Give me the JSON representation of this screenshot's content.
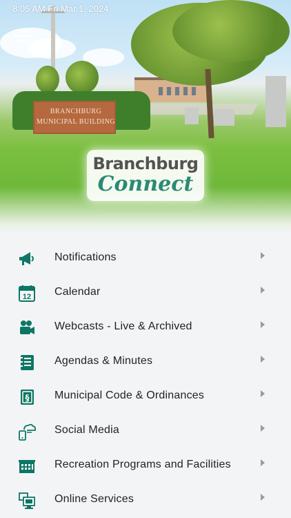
{
  "status_bar": {
    "time_date": "8:05 AM  Fri Mar 1, 2024"
  },
  "header": {
    "background_sign_line1": "BRANCHBURG",
    "background_sign_line2": "MUNICIPAL BUILDING",
    "logo_top": "Branchburg",
    "logo_bottom": "Connect"
  },
  "colors": {
    "accent": "#0e7665",
    "logo_green": "#2b8a73",
    "menu_bg": "#f3f4f6",
    "label": "#222222",
    "chevron": "#9a9a9a"
  },
  "menu": {
    "items": [
      {
        "label": "Notifications",
        "icon": "megaphone-icon"
      },
      {
        "label": "Calendar",
        "icon": "calendar-icon"
      },
      {
        "label": "Webcasts - Live & Archived",
        "icon": "video-camera-icon"
      },
      {
        "label": "Agendas & Minutes",
        "icon": "notebook-icon"
      },
      {
        "label": "Municipal Code & Ordinances",
        "icon": "section-book-icon"
      },
      {
        "label": "Social Media",
        "icon": "phone-cloud-icon"
      },
      {
        "label": "Recreation Programs and Facilities",
        "icon": "facility-icon"
      },
      {
        "label": "Online Services",
        "icon": "online-services-icon"
      }
    ],
    "calendar_icon_day": "12"
  }
}
